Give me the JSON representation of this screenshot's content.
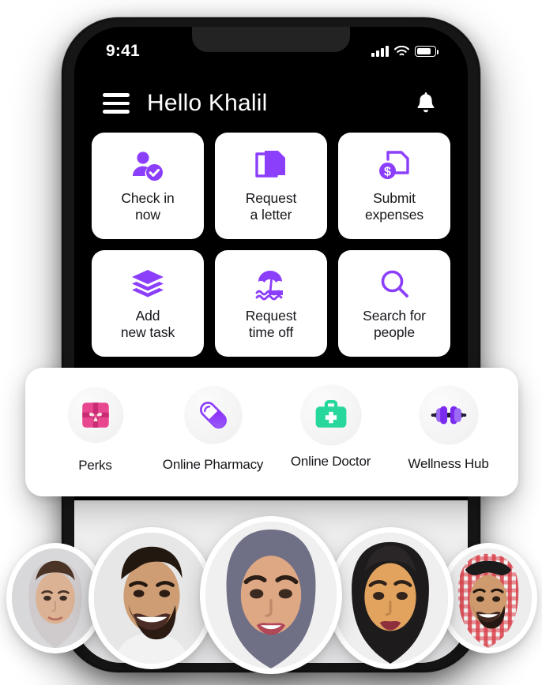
{
  "theme": {
    "accent_purple": "#8C3FFA",
    "screen_background": "#000000",
    "card_background": "#FFFFFF",
    "text_dark": "#15161A",
    "perks_pink": "#E8468F",
    "doctor_green": "#27D79C",
    "dumbbell_dark": "#241C3B"
  },
  "status_bar": {
    "time": "9:41",
    "signal_icon": "cellular-signal-icon",
    "wifi_icon": "wifi-icon",
    "battery_icon": "battery-icon"
  },
  "header": {
    "menu_icon": "hamburger-menu-icon",
    "greeting": "Hello Khalil",
    "notification_icon": "bell-icon"
  },
  "quick_actions": [
    {
      "label": "Check in\nnow",
      "icon": "user-check-icon"
    },
    {
      "label": "Request\na letter",
      "icon": "documents-icon"
    },
    {
      "label": "Submit\nexpenses",
      "icon": "receipt-dollar-icon"
    },
    {
      "label": "Add\nnew task",
      "icon": "layers-stack-icon"
    },
    {
      "label": "Request\ntime off",
      "icon": "beach-umbrella-icon"
    },
    {
      "label": "Search for\npeople",
      "icon": "magnifier-search-icon"
    }
  ],
  "services": [
    {
      "label": "Perks",
      "icon": "gift-box-icon"
    },
    {
      "label": "Online Pharmacy",
      "icon": "pill-capsule-icon"
    },
    {
      "label": "Online Doctor",
      "icon": "medical-bag-icon"
    },
    {
      "label": "Wellness Hub",
      "icon": "dumbbell-icon"
    }
  ],
  "avatars": [
    {
      "name": "avatar-person-1"
    },
    {
      "name": "avatar-person-2"
    },
    {
      "name": "avatar-person-3"
    },
    {
      "name": "avatar-person-4"
    },
    {
      "name": "avatar-person-5"
    }
  ]
}
